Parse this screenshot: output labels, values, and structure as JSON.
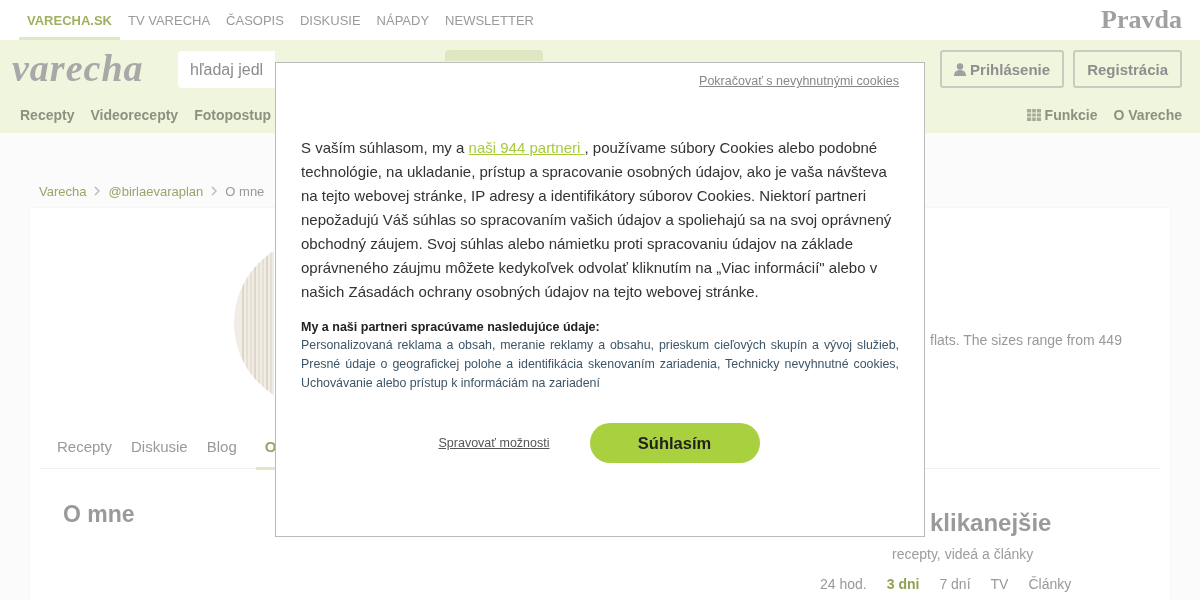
{
  "top_nav": [
    {
      "label": "VARECHA.SK",
      "selected": true
    },
    {
      "label": "TV VARECHA",
      "selected": false
    },
    {
      "label": "ČASOPIS",
      "selected": false
    },
    {
      "label": "DISKUSIE",
      "selected": false
    },
    {
      "label": "NÁPADY",
      "selected": false
    },
    {
      "label": "NEWSLETTER",
      "selected": false
    }
  ],
  "brand_logo": "Pravda",
  "header": {
    "logo": "varecha",
    "search": {
      "placeholder": "hľadaj jedl"
    },
    "login": "Prihlásenie",
    "register": "Registrácia"
  },
  "main_nav": [
    "Recepty",
    "Videorecepty",
    "Fotopostup"
  ],
  "right_nav": [
    {
      "label": "Funkcie",
      "kind": "grid"
    },
    {
      "label": "O Vareche",
      "kind": "plain"
    }
  ],
  "breadcrumb": [
    "Varecha",
    "@birlaevaraplan",
    "O mne"
  ],
  "profile": {
    "bio": "flats. The sizes range from 449",
    "tabs": [
      {
        "label": "Recepty",
        "selected": false
      },
      {
        "label": "Diskusie",
        "selected": false
      },
      {
        "label": "Blog",
        "selected": false
      },
      {
        "label": "O",
        "selected": true
      }
    ]
  },
  "about_title": "O mne",
  "popular": {
    "title": "klikanejšie",
    "subtitle": "recepty, videá a články",
    "tabs": [
      {
        "label": "24 hod.",
        "selected": false
      },
      {
        "label": "3 dni",
        "selected": true
      },
      {
        "label": "7 dní",
        "selected": false
      },
      {
        "label": "TV",
        "selected": false
      },
      {
        "label": "Články",
        "selected": false
      }
    ]
  },
  "consent": {
    "skip_link": "Pokračovať s nevyhnutnými cookies",
    "intro_before": "S vaším súhlasom, my a ",
    "intro_link": "naši 944 partneri ",
    "intro_after": ", používame súbory Cookies alebo podobné technológie, na ukladanie, prístup a spracovanie osobných údajov, ako je vaša návšteva na tejto webovej stránke, IP adresy a identifikátory súborov Cookies. Niektorí partneri nepožadujú Váš súhlas so spracovaním vašich údajov a spoliehajú sa na svoj oprávnený obchodný záujem. Svoj súhlas alebo námietku proti spracovaniu údajov na základe oprávneného záujmu môžete kedykoľvek odvolať kliknutím na „Viac informácií\" alebo v našich Zásadách ochrany osobných údajov na tejto webovej stránke.",
    "purposes_heading": "My a naši partneri spracúvame nasledujúce údaje:",
    "purposes": "Personalizovaná reklama a obsah, meranie reklamy a obsahu, prieskum cieľových skupín a vývoj služieb, Presné údaje o geografickej polohe a identifikácia skenovaním zariadenia, Technicky nevyhnutné cookies, Uchovávanie alebo prístup k informáciám na zariadení",
    "manage_link": "Spravovať možnosti",
    "accept_button": "Súhlasím"
  }
}
